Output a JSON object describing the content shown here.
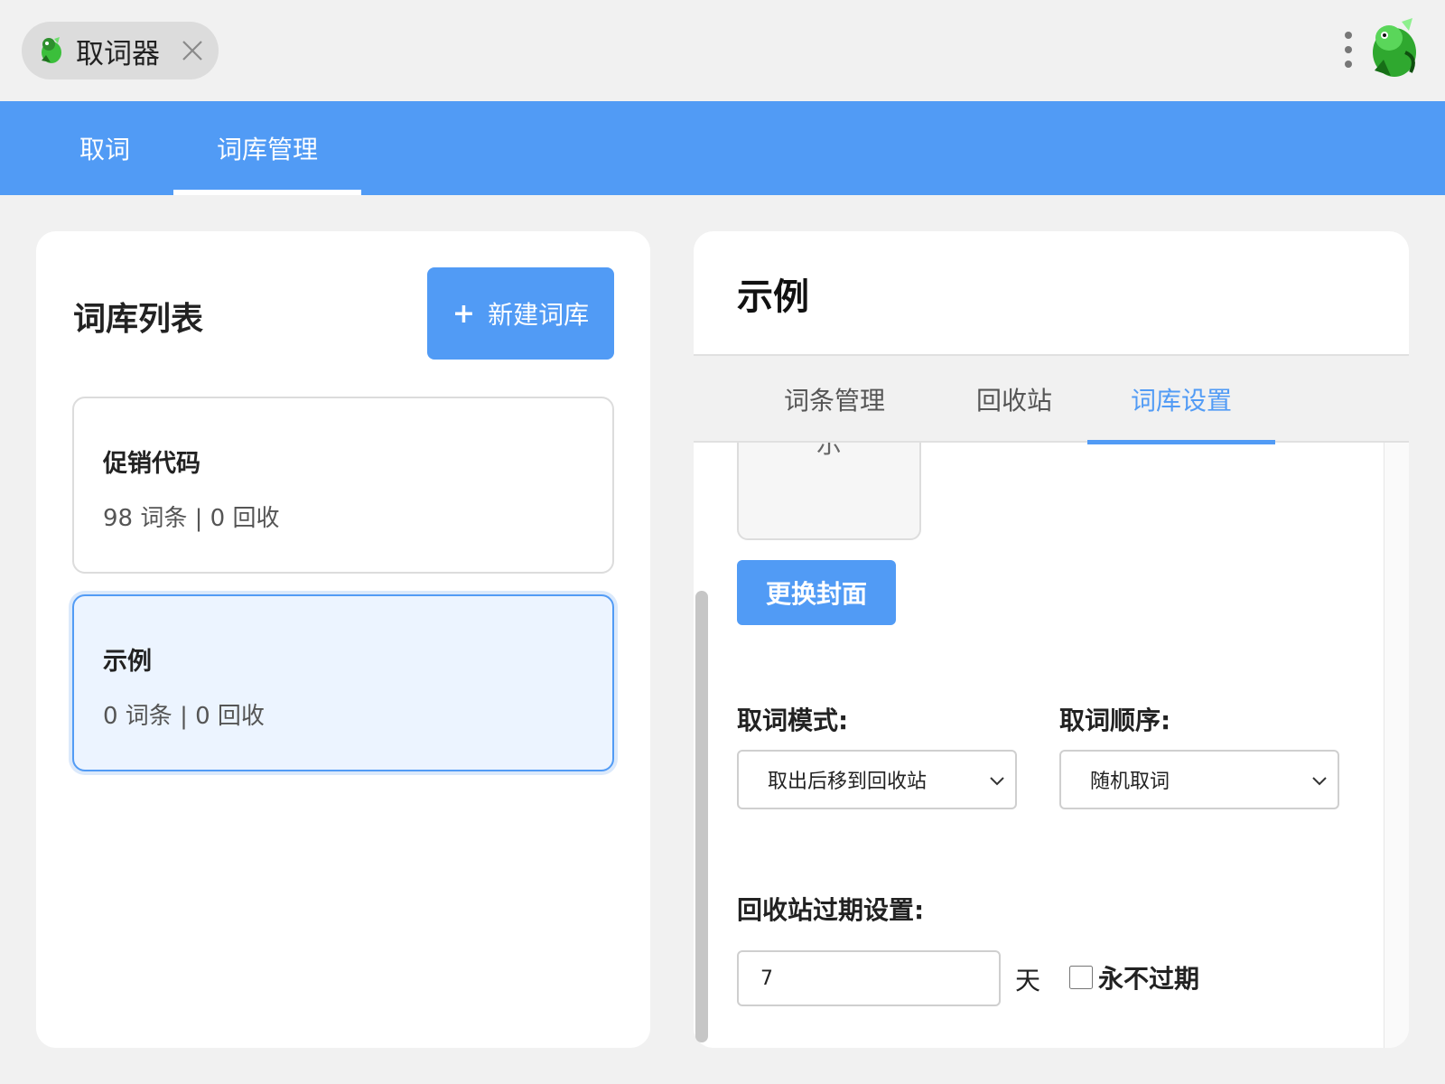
{
  "window": {
    "app_title": "取词器",
    "icons": {
      "app": "dragon-icon",
      "close": "close-icon",
      "more": "more-vertical-icon",
      "avatar": "dragon-avatar-icon"
    }
  },
  "nav": {
    "tabs": [
      {
        "label": "取词",
        "active": false
      },
      {
        "label": "词库管理",
        "active": true
      }
    ]
  },
  "library_list": {
    "heading": "词库列表",
    "new_button": {
      "plus": "+",
      "label": "新建词库"
    },
    "items": [
      {
        "name": "促销代码",
        "meta": "98 词条 | 0 回收",
        "selected": false
      },
      {
        "name": "示例",
        "meta": "0 词条 | 0 回收",
        "selected": true
      }
    ]
  },
  "detail": {
    "title": "示例",
    "tabs": [
      {
        "label": "词条管理",
        "active": false
      },
      {
        "label": "回收站",
        "active": false
      },
      {
        "label": "词库设置",
        "active": true
      }
    ],
    "settings": {
      "cover_text": "示",
      "change_cover_label": "更换封面",
      "mode": {
        "label": "取词模式:",
        "value": "取出后移到回收站"
      },
      "order": {
        "label": "取词顺序:",
        "value": "随机取词"
      },
      "expiry": {
        "label": "回收站过期设置:",
        "days": "7",
        "unit": "天",
        "never_label": "永不过期",
        "never_checked": false
      }
    }
  },
  "colors": {
    "accent": "#519bf5",
    "background": "#f1f1f1",
    "selected_card_bg": "#ecf4ff"
  }
}
